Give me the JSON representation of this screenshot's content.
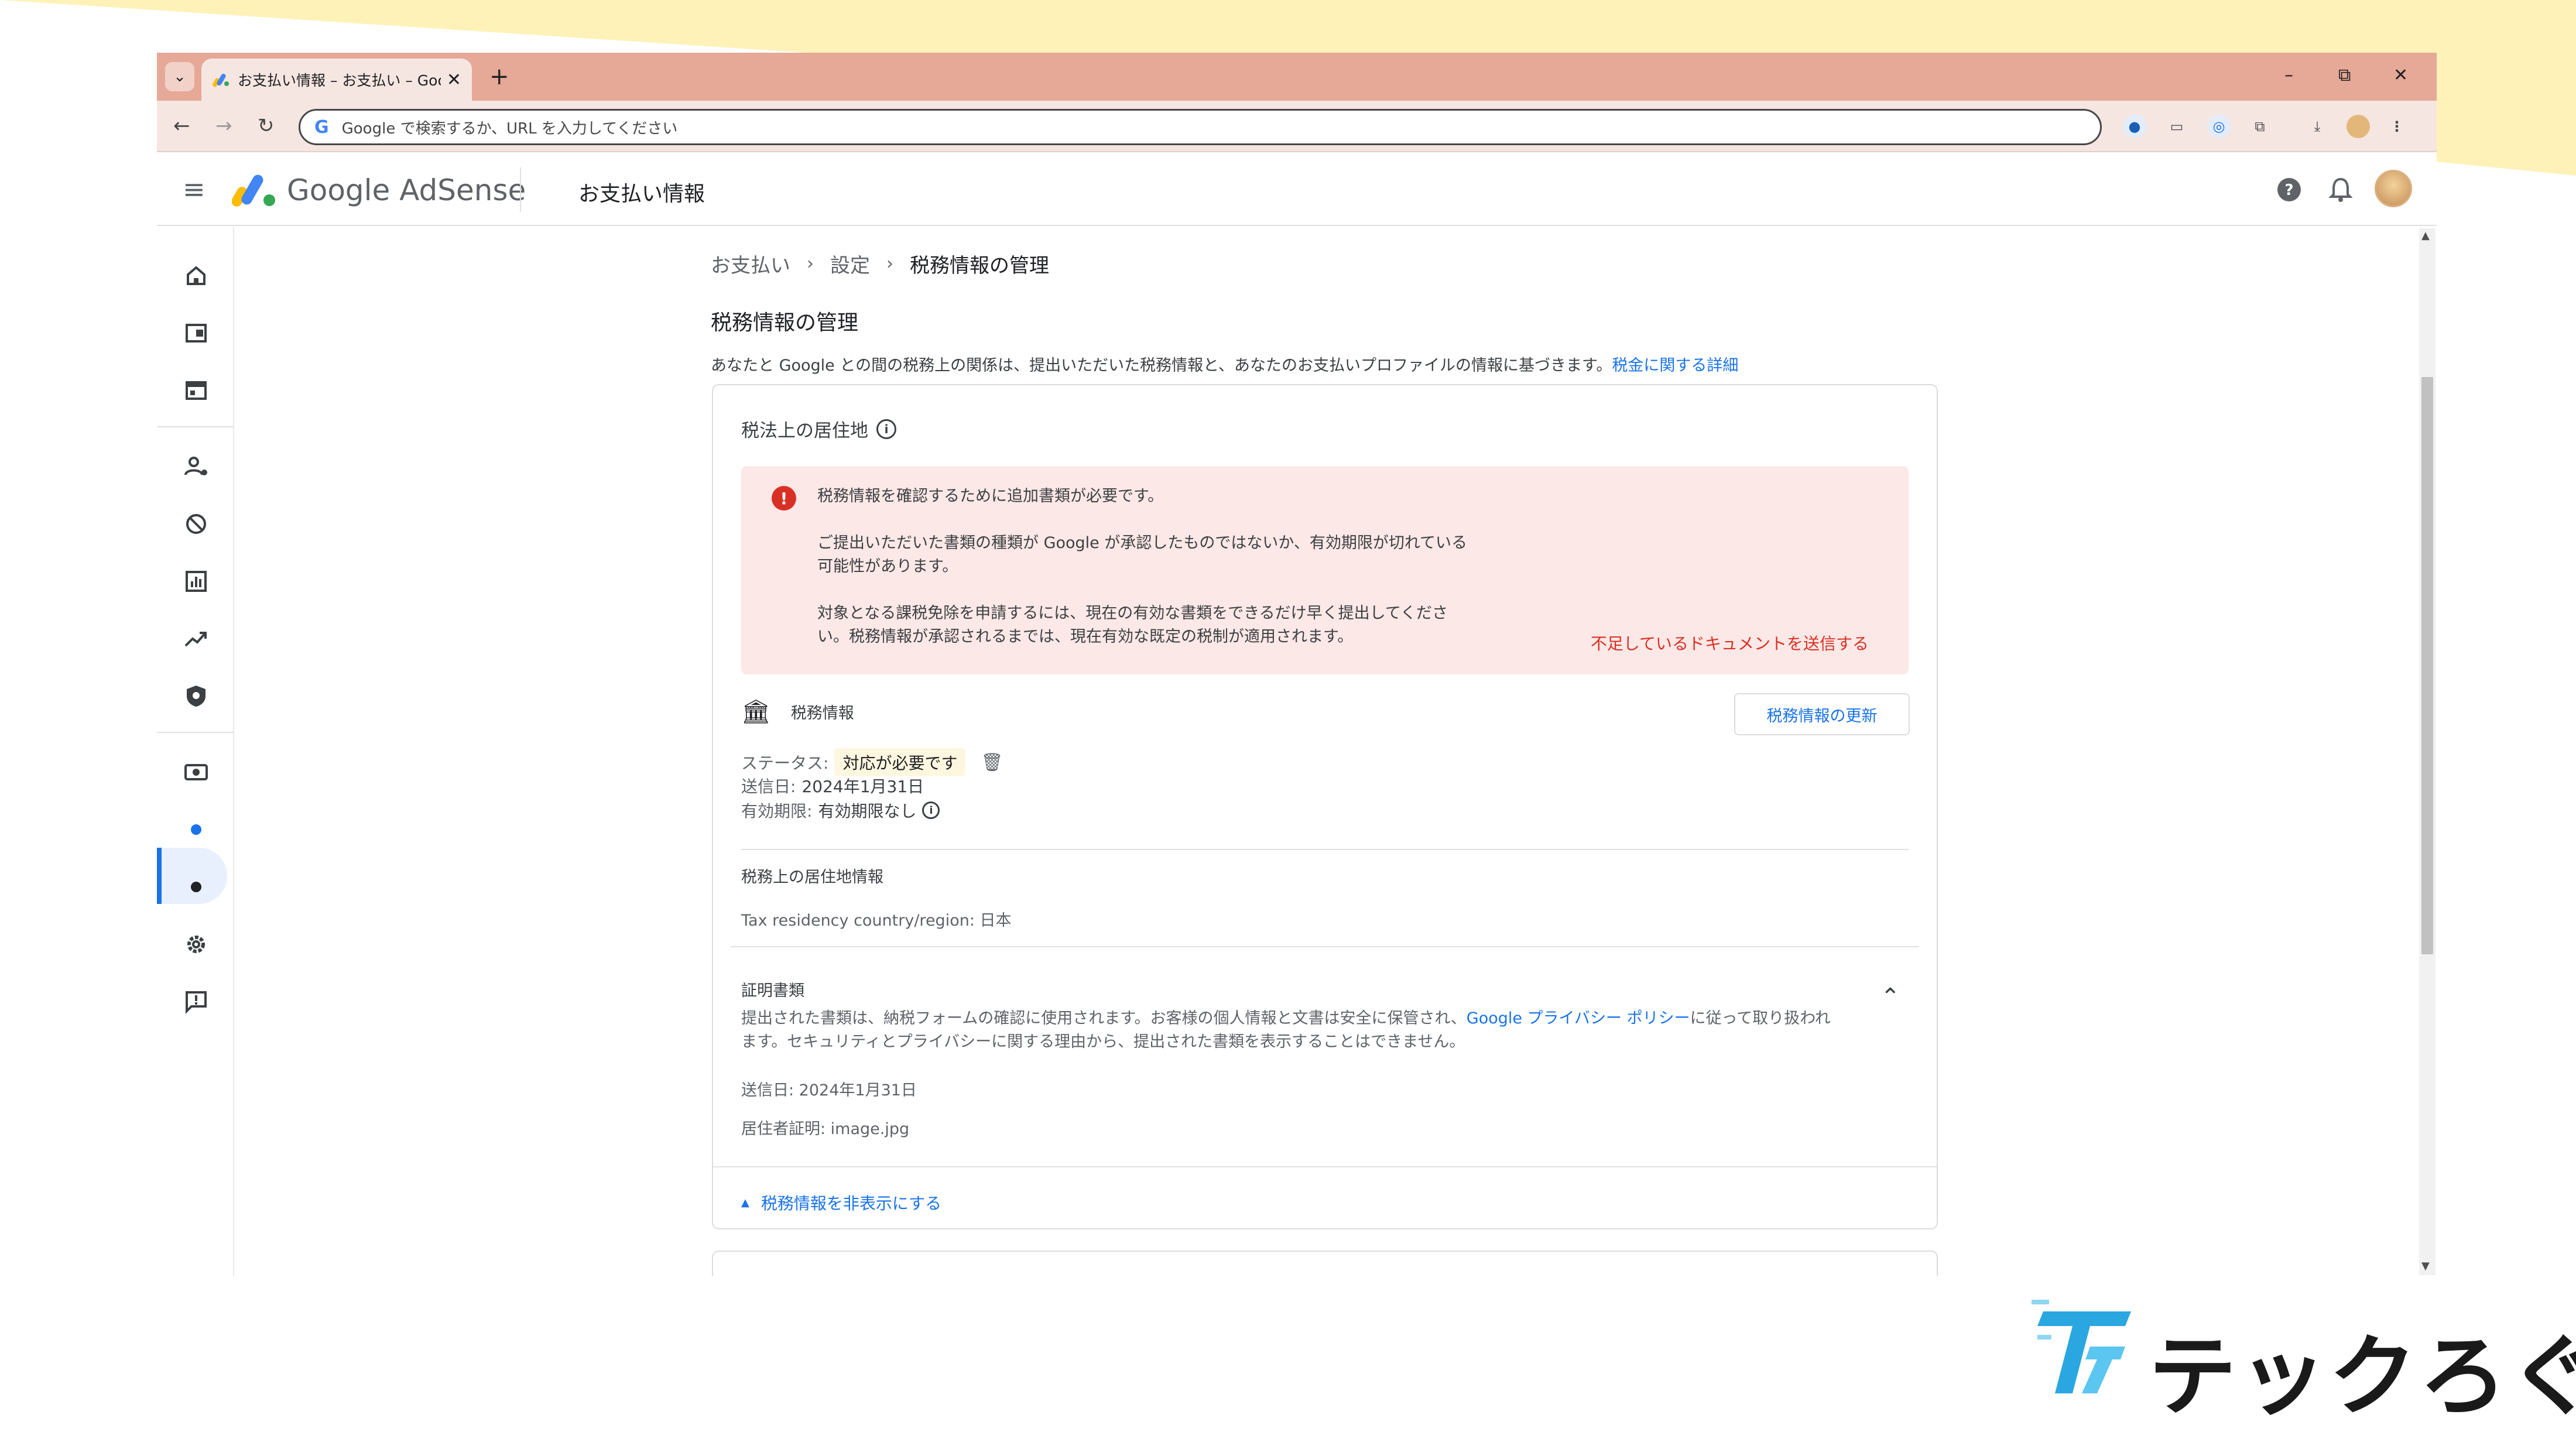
{
  "browser": {
    "tab_title": "お支払い情報 – お支払い – Goog",
    "tab_close": "✕",
    "new_tab": "+",
    "window_controls": [
      "–",
      "⧉",
      "✕"
    ],
    "omnibox_placeholder": "Google で検索するか、URL を入力してください"
  },
  "header": {
    "brand": "Google AdSense",
    "page_title": "お支払い情報"
  },
  "breadcrumb": [
    "お支払い",
    "設定",
    "税務情報の管理"
  ],
  "section": {
    "heading": "税務情報の管理",
    "intro": "あなたと Google との間の税務上の関係は、提出いただいた税務情報と、あなたのお支払いプロファイルの情報に基づきます。",
    "intro_link": "税金に関する詳細"
  },
  "card": {
    "heading": "税法上の居住地",
    "alert": {
      "title": "税務情報を確認するために追加書類が必要です。",
      "body1_line1": "ご提出いただいた書類の種類が Google が承認したものではないか、有効期限が切れている",
      "body1_line2": "可能性があります。",
      "body2_line1": "対象となる課税免除を申請するには、現在の有効な書類をできるだけ早く提出してくださ",
      "body2_line2": "い。税務情報が承認されるまでは、現在有効な既定の税制が適用されます。",
      "action": "不足しているドキュメントを送信する"
    },
    "tax_info_label": "税務情報",
    "update_button": "税務情報の更新",
    "status_label": "ステータス:",
    "status_value": "対応が必要です",
    "sent_label": "送信日:",
    "sent_value": "2024年1月31日",
    "expiry_label": "有効期限:",
    "expiry_value": "有効期限なし",
    "residency_heading": "税務上の居住地情報",
    "residency_line": "Tax residency country/region: 日本",
    "proof_heading": "証明書類",
    "proof_para_pre": "提出された書類は、納税フォームの確認に使用されます。お客様の個人情報と文書は安全に保管され、",
    "proof_para_link": "Google プライバシー ポリシー",
    "proof_para_post": "に従って取り扱われ",
    "proof_para_line2": "ます。セキュリティとプライバシーに関する理由から、提出された書類を表示することはできません。",
    "proof_sent": "送信日: 2024年1月31日",
    "proof_file": "居住者証明: image.jpg",
    "hide_link": "税務情報を非表示にする"
  },
  "watermark": {
    "text": "テックろぐ"
  },
  "colors": {
    "titlebar": "#e6a897",
    "toolbar": "#f6e6e1",
    "accent_blue": "#1a73e8",
    "alert_bg": "#fce8e6",
    "alert_red": "#d93025",
    "background_band": "#fff2b8"
  },
  "icons": {
    "rail": [
      "home-icon",
      "ads-icon",
      "sites-icon",
      "account-icon",
      "blocking-icon",
      "reports-icon",
      "optimization-icon",
      "privacy-icon",
      "payments-icon",
      "settings-icon",
      "feedback-icon"
    ]
  }
}
